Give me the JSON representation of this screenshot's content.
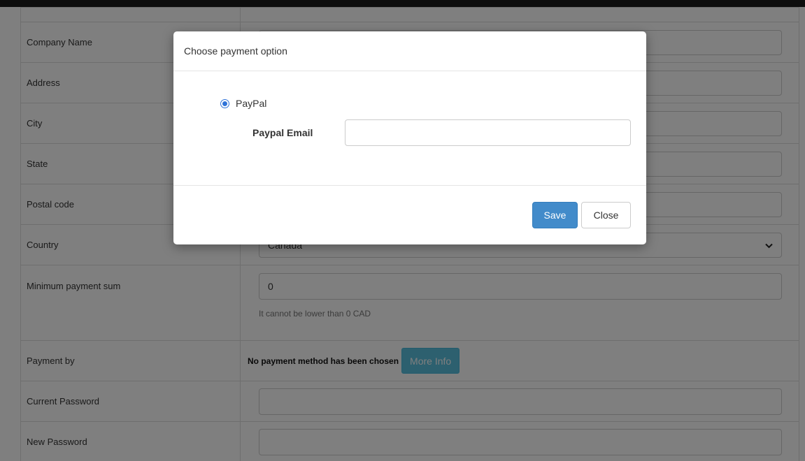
{
  "form": {
    "rows": {
      "company_name": {
        "label": "Company Name",
        "value": ""
      },
      "address": {
        "label": "Address",
        "value": ""
      },
      "city": {
        "label": "City",
        "value": ""
      },
      "state": {
        "label": "State",
        "value": ""
      },
      "postal_code": {
        "label": "Postal code",
        "value": ""
      },
      "country": {
        "label": "Country",
        "value": "Canada"
      },
      "minimum_payment": {
        "label": "Minimum payment sum",
        "value": "0",
        "help": "It cannot be lower than 0 CAD"
      },
      "payment_by": {
        "label": "Payment by",
        "status": "No payment method has been chosen",
        "info_button": "More Info"
      },
      "current_password": {
        "label": "Current Password",
        "value": ""
      },
      "new_password": {
        "label": "New Password",
        "value": ""
      }
    }
  },
  "modal": {
    "title": "Choose payment option",
    "option": {
      "label": "PayPal",
      "selected": true
    },
    "email_label": "Paypal Email",
    "email_value": "",
    "save_label": "Save",
    "close_label": "Close"
  },
  "colors": {
    "overlay": "#000000",
    "primary": "#428bca",
    "info": "#5bc0de",
    "radio": "#2f73d8"
  }
}
